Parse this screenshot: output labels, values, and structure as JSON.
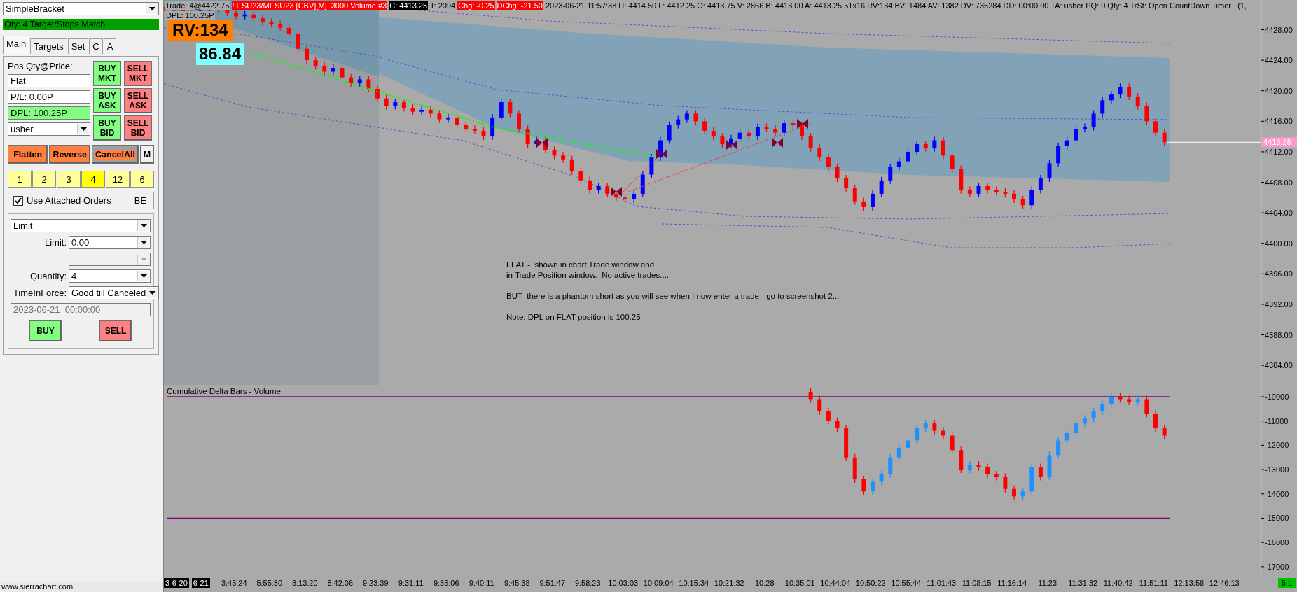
{
  "order_panel": {
    "strategy_dropdown": {
      "value": "SimpleBracket"
    },
    "status_bar": {
      "text": "Qty: 4 Target/Stops Match"
    },
    "tabs": [
      {
        "label": "Main",
        "selected": true
      },
      {
        "label": "Targets",
        "selected": false
      },
      {
        "label": "Set",
        "selected": false
      },
      {
        "label": "C",
        "selected": false
      },
      {
        "label": "A",
        "selected": false
      }
    ],
    "position": {
      "label": "Pos Qty@Price:",
      "value": "Flat"
    },
    "pl_field": {
      "value": "P/L: 0.00P"
    },
    "dpl_field": {
      "value": "DPL: 100.25P"
    },
    "account_dropdown": {
      "value": "usher"
    },
    "quick_buttons": [
      {
        "label": "BUY MKT",
        "kind": "buy"
      },
      {
        "label": "SELL MKT",
        "kind": "sell"
      },
      {
        "label": "BUY ASK",
        "kind": "buy"
      },
      {
        "label": "SELL ASK",
        "kind": "sell"
      },
      {
        "label": "BUY BID",
        "kind": "buy"
      },
      {
        "label": "SELL BID",
        "kind": "sell"
      }
    ],
    "action_buttons": [
      {
        "label": "Flatten",
        "kind": "action"
      },
      {
        "label": "Reverse",
        "kind": "action"
      },
      {
        "label": "CancelAll",
        "kind": "cancel"
      },
      {
        "label": "M",
        "kind": "plain"
      }
    ],
    "quantity_buttons": [
      {
        "label": "1",
        "selected": false
      },
      {
        "label": "2",
        "selected": false
      },
      {
        "label": "3",
        "selected": false
      },
      {
        "label": "4",
        "selected": true
      },
      {
        "label": "12",
        "selected": false
      },
      {
        "label": "6",
        "selected": false
      }
    ],
    "attached_orders": {
      "label": "Use Attached Orders",
      "checked": true
    },
    "be_button": {
      "label": "BE"
    },
    "order_type": {
      "value": "Limit"
    },
    "form_rows": [
      {
        "label": "Limit:",
        "value": "0.00",
        "disabled": false
      },
      {
        "disabled": true
      },
      {
        "label": "Quantity:",
        "value": "4",
        "disabled": false
      },
      {
        "label": "TimeInForce:",
        "value": "Good till Canceled",
        "disabled": false
      }
    ],
    "expiry_field": {
      "value": "2023-06-21  00:00:00",
      "disabled": true
    },
    "order_buttons": [
      {
        "label": "BUY",
        "kind": "buy"
      },
      {
        "label": "SELL",
        "kind": "sell"
      }
    ]
  },
  "footer_link": "www.sierrachart.com",
  "chart": {
    "header": [
      {
        "text": "Trade: 4@4422.75",
        "kind": "plain"
      },
      {
        "text": "! ESU23/MESU23 [CBV][M]  3000 Volume #3",
        "kind": "alert"
      },
      {
        "text": "C: 4413.25",
        "kind": "price"
      },
      {
        "text": "T: 2094",
        "kind": "plain"
      },
      {
        "text": "Chg: -0.25",
        "kind": "alert"
      },
      {
        "text": "DChg: -21.50",
        "kind": "alert"
      },
      {
        "text": "2023-06-21 11:57:38 H: 4414.50 L: 4412.25 O: 4413.75 V: 2866 B: 4413.00 A: 4413.25 51x16 RV:134 BV: 1484 AV: 1382 DV: 735284 DD: 00:00:00 TA: usher PQ: 0 Qty: 4 TrSt: Open CountDown Timer   (1,",
        "kind": "plain"
      }
    ],
    "dpl_line": "DPL: 100.25P",
    "rv_label": "RV:134",
    "value_label": "86.84",
    "note": [
      "FLAT -  shown in chart Trade window and\nin Trade Position window.  No active trades....",
      "BUT  there is a phantom short as you will see when I now enter a trade - go to screenshot 2...",
      "Note: DPL on FLAT position is 100.25"
    ],
    "price_pane": {
      "axis_labels": [
        "4428.00",
        "4424.00",
        "4420.00",
        "4416.00",
        "4412.00",
        "4408.00",
        "4404.00",
        "4400.00",
        "4396.00",
        "4392.00",
        "4388.00",
        "4384.00"
      ],
      "current_price": "4413.25"
    },
    "delta_pane": {
      "title": "Cumulative Delta Bars - Volume",
      "axis_labels": [
        "-10000",
        "-11000",
        "-12000",
        "-13000",
        "-14000",
        "-15000",
        "-16000",
        "-17000"
      ]
    },
    "time_axis": {
      "date_labels": [
        "3-6-20",
        "6-21"
      ],
      "time_labels": [
        "3:45:24",
        "5:55:30",
        "8:13:20",
        "8:42:06",
        "9:23:39",
        "9:31:11",
        "9:35:06",
        "9:40:11",
        "9:45:38",
        "9:51:47",
        "9:58:23",
        "10:03:03",
        "10:09:04",
        "10:15:34",
        "10:21:32",
        "10:28",
        "10:35:01",
        "10:44:04",
        "10:50:22",
        "10:55:44",
        "11:01:43",
        "11:08:15",
        "11:16:14",
        "11:23",
        "11:31:32",
        "11:40:42",
        "11:51:11",
        "12:13:58",
        "12:46:13"
      ],
      "badge": "5 L"
    }
  }
}
